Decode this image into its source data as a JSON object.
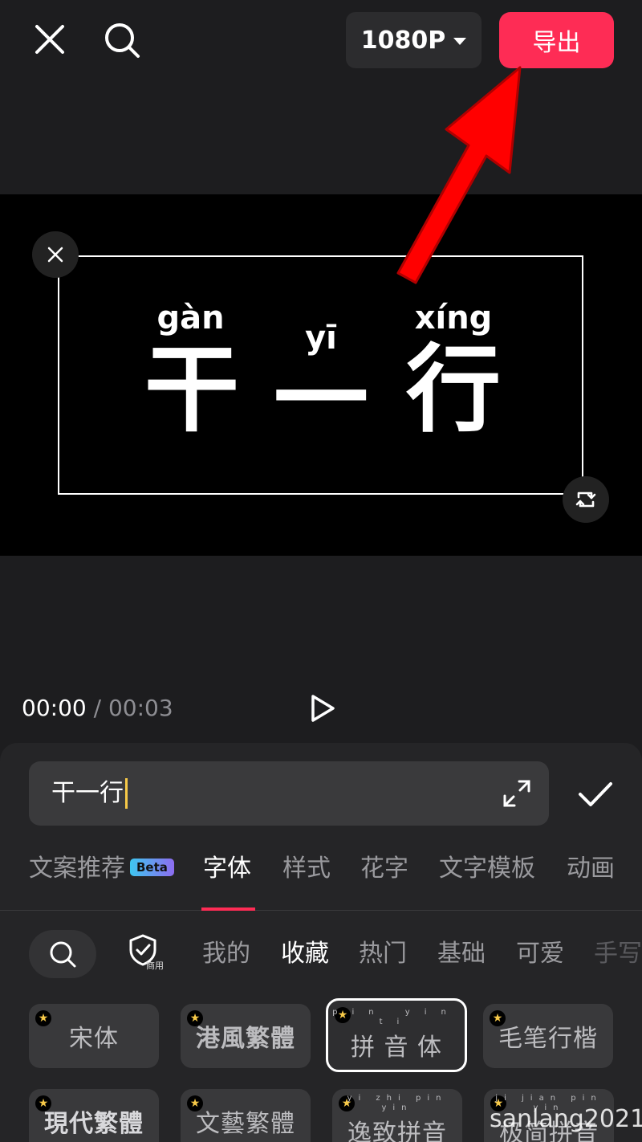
{
  "header": {
    "resolution": "1080P",
    "export_label": "导出"
  },
  "preview": {
    "characters": [
      {
        "pinyin": "gàn",
        "hanzi": "干"
      },
      {
        "pinyin": "yī",
        "hanzi": "一"
      },
      {
        "pinyin": "xíng",
        "hanzi": "行"
      }
    ]
  },
  "timeline": {
    "current": "00:00",
    "separator": "/",
    "total": "00:03"
  },
  "editor": {
    "input_value": "干一行"
  },
  "tabs": [
    {
      "label": "文案推荐",
      "badge": "Beta"
    },
    {
      "label": "字体"
    },
    {
      "label": "样式"
    },
    {
      "label": "花字"
    },
    {
      "label": "文字模板"
    },
    {
      "label": "动画"
    }
  ],
  "categories": {
    "shield_label": "商用",
    "items": [
      "我的",
      "收藏",
      "热门",
      "基础",
      "可爱",
      "手写"
    ]
  },
  "fonts": [
    {
      "label": "宋体"
    },
    {
      "label": "港風繁體"
    },
    {
      "label": "拼 音 体",
      "pinyin": "pin yin ti"
    },
    {
      "label": "毛笔行楷"
    },
    {
      "label": "現代繁體"
    },
    {
      "label": "文藝繁體"
    },
    {
      "label": "逸致拼音",
      "pinyin": "yi zhi pin yin"
    },
    {
      "label": "极简拼音",
      "pinyin": "ji jian pin yin"
    }
  ],
  "watermark": "sanlang2021",
  "colors": {
    "accent": "#fe2c55",
    "caret": "#f7c948",
    "arrow": "#ff0000"
  }
}
